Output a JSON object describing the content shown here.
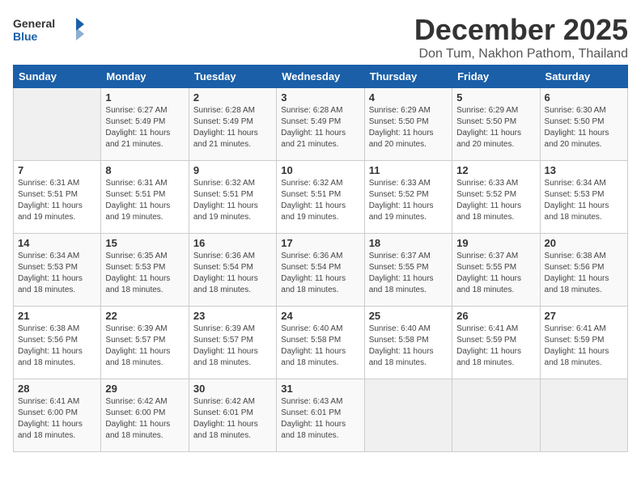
{
  "logo": {
    "general": "General",
    "blue": "Blue"
  },
  "title": "December 2025",
  "subtitle": "Don Tum, Nakhon Pathom, Thailand",
  "weekdays": [
    "Sunday",
    "Monday",
    "Tuesday",
    "Wednesday",
    "Thursday",
    "Friday",
    "Saturday"
  ],
  "weeks": [
    [
      {
        "day": "",
        "sunrise": "",
        "sunset": "",
        "daylight": ""
      },
      {
        "day": "1",
        "sunrise": "Sunrise: 6:27 AM",
        "sunset": "Sunset: 5:49 PM",
        "daylight": "Daylight: 11 hours and 21 minutes."
      },
      {
        "day": "2",
        "sunrise": "Sunrise: 6:28 AM",
        "sunset": "Sunset: 5:49 PM",
        "daylight": "Daylight: 11 hours and 21 minutes."
      },
      {
        "day": "3",
        "sunrise": "Sunrise: 6:28 AM",
        "sunset": "Sunset: 5:49 PM",
        "daylight": "Daylight: 11 hours and 21 minutes."
      },
      {
        "day": "4",
        "sunrise": "Sunrise: 6:29 AM",
        "sunset": "Sunset: 5:50 PM",
        "daylight": "Daylight: 11 hours and 20 minutes."
      },
      {
        "day": "5",
        "sunrise": "Sunrise: 6:29 AM",
        "sunset": "Sunset: 5:50 PM",
        "daylight": "Daylight: 11 hours and 20 minutes."
      },
      {
        "day": "6",
        "sunrise": "Sunrise: 6:30 AM",
        "sunset": "Sunset: 5:50 PM",
        "daylight": "Daylight: 11 hours and 20 minutes."
      }
    ],
    [
      {
        "day": "7",
        "sunrise": "Sunrise: 6:31 AM",
        "sunset": "Sunset: 5:51 PM",
        "daylight": "Daylight: 11 hours and 19 minutes."
      },
      {
        "day": "8",
        "sunrise": "Sunrise: 6:31 AM",
        "sunset": "Sunset: 5:51 PM",
        "daylight": "Daylight: 11 hours and 19 minutes."
      },
      {
        "day": "9",
        "sunrise": "Sunrise: 6:32 AM",
        "sunset": "Sunset: 5:51 PM",
        "daylight": "Daylight: 11 hours and 19 minutes."
      },
      {
        "day": "10",
        "sunrise": "Sunrise: 6:32 AM",
        "sunset": "Sunset: 5:51 PM",
        "daylight": "Daylight: 11 hours and 19 minutes."
      },
      {
        "day": "11",
        "sunrise": "Sunrise: 6:33 AM",
        "sunset": "Sunset: 5:52 PM",
        "daylight": "Daylight: 11 hours and 19 minutes."
      },
      {
        "day": "12",
        "sunrise": "Sunrise: 6:33 AM",
        "sunset": "Sunset: 5:52 PM",
        "daylight": "Daylight: 11 hours and 18 minutes."
      },
      {
        "day": "13",
        "sunrise": "Sunrise: 6:34 AM",
        "sunset": "Sunset: 5:53 PM",
        "daylight": "Daylight: 11 hours and 18 minutes."
      }
    ],
    [
      {
        "day": "14",
        "sunrise": "Sunrise: 6:34 AM",
        "sunset": "Sunset: 5:53 PM",
        "daylight": "Daylight: 11 hours and 18 minutes."
      },
      {
        "day": "15",
        "sunrise": "Sunrise: 6:35 AM",
        "sunset": "Sunset: 5:53 PM",
        "daylight": "Daylight: 11 hours and 18 minutes."
      },
      {
        "day": "16",
        "sunrise": "Sunrise: 6:36 AM",
        "sunset": "Sunset: 5:54 PM",
        "daylight": "Daylight: 11 hours and 18 minutes."
      },
      {
        "day": "17",
        "sunrise": "Sunrise: 6:36 AM",
        "sunset": "Sunset: 5:54 PM",
        "daylight": "Daylight: 11 hours and 18 minutes."
      },
      {
        "day": "18",
        "sunrise": "Sunrise: 6:37 AM",
        "sunset": "Sunset: 5:55 PM",
        "daylight": "Daylight: 11 hours and 18 minutes."
      },
      {
        "day": "19",
        "sunrise": "Sunrise: 6:37 AM",
        "sunset": "Sunset: 5:55 PM",
        "daylight": "Daylight: 11 hours and 18 minutes."
      },
      {
        "day": "20",
        "sunrise": "Sunrise: 6:38 AM",
        "sunset": "Sunset: 5:56 PM",
        "daylight": "Daylight: 11 hours and 18 minutes."
      }
    ],
    [
      {
        "day": "21",
        "sunrise": "Sunrise: 6:38 AM",
        "sunset": "Sunset: 5:56 PM",
        "daylight": "Daylight: 11 hours and 18 minutes."
      },
      {
        "day": "22",
        "sunrise": "Sunrise: 6:39 AM",
        "sunset": "Sunset: 5:57 PM",
        "daylight": "Daylight: 11 hours and 18 minutes."
      },
      {
        "day": "23",
        "sunrise": "Sunrise: 6:39 AM",
        "sunset": "Sunset: 5:57 PM",
        "daylight": "Daylight: 11 hours and 18 minutes."
      },
      {
        "day": "24",
        "sunrise": "Sunrise: 6:40 AM",
        "sunset": "Sunset: 5:58 PM",
        "daylight": "Daylight: 11 hours and 18 minutes."
      },
      {
        "day": "25",
        "sunrise": "Sunrise: 6:40 AM",
        "sunset": "Sunset: 5:58 PM",
        "daylight": "Daylight: 11 hours and 18 minutes."
      },
      {
        "day": "26",
        "sunrise": "Sunrise: 6:41 AM",
        "sunset": "Sunset: 5:59 PM",
        "daylight": "Daylight: 11 hours and 18 minutes."
      },
      {
        "day": "27",
        "sunrise": "Sunrise: 6:41 AM",
        "sunset": "Sunset: 5:59 PM",
        "daylight": "Daylight: 11 hours and 18 minutes."
      }
    ],
    [
      {
        "day": "28",
        "sunrise": "Sunrise: 6:41 AM",
        "sunset": "Sunset: 6:00 PM",
        "daylight": "Daylight: 11 hours and 18 minutes."
      },
      {
        "day": "29",
        "sunrise": "Sunrise: 6:42 AM",
        "sunset": "Sunset: 6:00 PM",
        "daylight": "Daylight: 11 hours and 18 minutes."
      },
      {
        "day": "30",
        "sunrise": "Sunrise: 6:42 AM",
        "sunset": "Sunset: 6:01 PM",
        "daylight": "Daylight: 11 hours and 18 minutes."
      },
      {
        "day": "31",
        "sunrise": "Sunrise: 6:43 AM",
        "sunset": "Sunset: 6:01 PM",
        "daylight": "Daylight: 11 hours and 18 minutes."
      },
      {
        "day": "",
        "sunrise": "",
        "sunset": "",
        "daylight": ""
      },
      {
        "day": "",
        "sunrise": "",
        "sunset": "",
        "daylight": ""
      },
      {
        "day": "",
        "sunrise": "",
        "sunset": "",
        "daylight": ""
      }
    ]
  ]
}
